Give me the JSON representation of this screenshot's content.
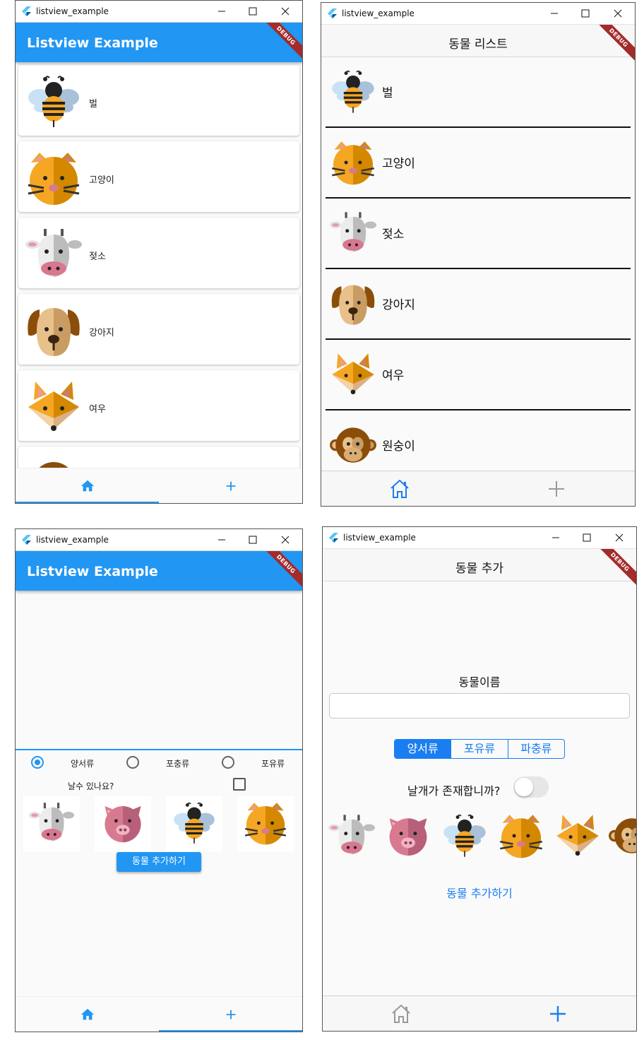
{
  "window_title": "listview_example",
  "debug_banner": "DEBUG",
  "material_appbar_title": "Listview Example",
  "animals": {
    "bee": "벌",
    "cat": "고양이",
    "cow": "젖소",
    "dog": "강아지",
    "fox": "여우",
    "monkey": "원숭이"
  },
  "cupertino_list_title": "동물 리스트",
  "material_add": {
    "radio_options": [
      "양서류",
      "포충류",
      "포유류"
    ],
    "selected_radio": "양서류",
    "fly_question": "날수 있나요?",
    "fly_checked": false,
    "add_button": "동물 추가하기"
  },
  "cupertino_add": {
    "title": "동물 추가",
    "name_label": "동물이름",
    "name_value": "",
    "segments": [
      "양서류",
      "포유류",
      "파충류"
    ],
    "selected_segment": "양서류",
    "wing_question": "날개가 존재합니까?",
    "wing_switch_on": false,
    "add_button": "동물 추가하기"
  },
  "icons": {
    "home": "home-icon",
    "add": "plus-icon"
  },
  "colors": {
    "material_primary": "#2196f3",
    "cupertino_accent": "#1a7df2",
    "debug_banner": "#a32b2b"
  }
}
